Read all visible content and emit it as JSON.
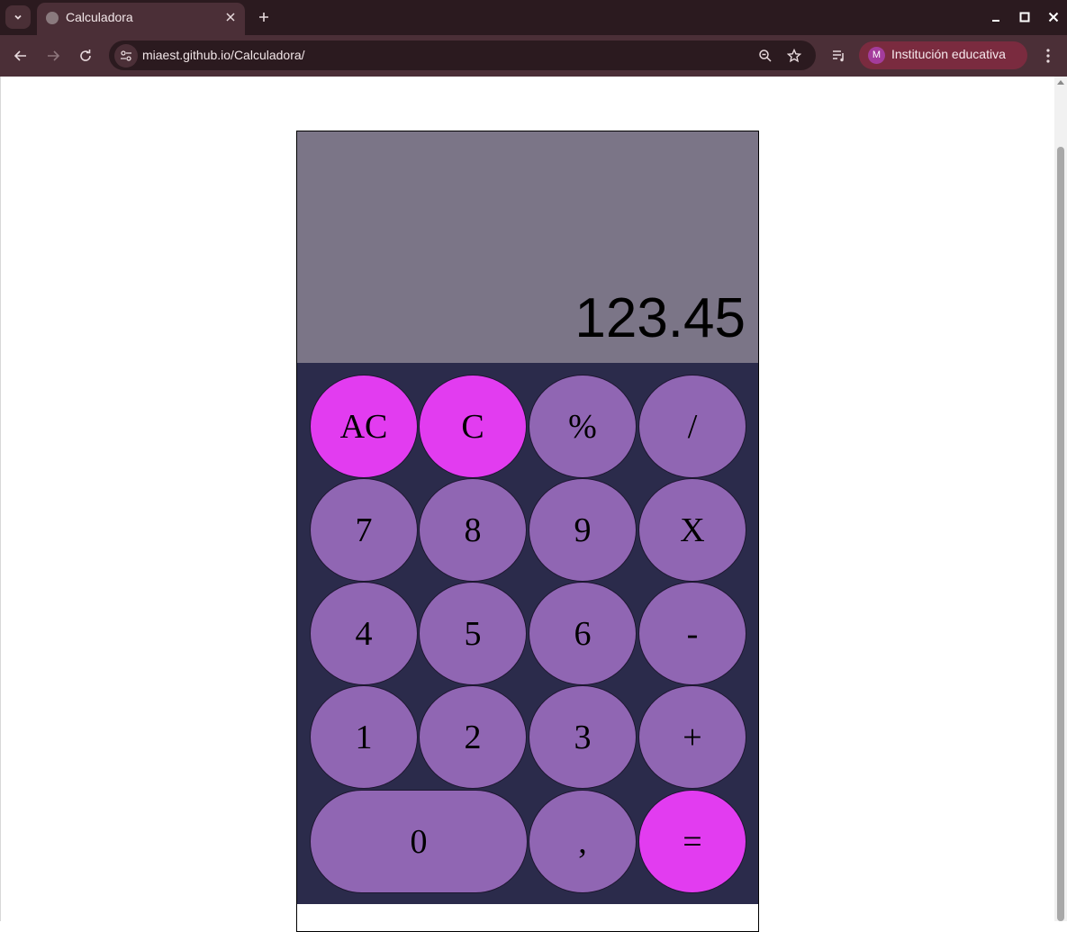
{
  "browser": {
    "tab_title": "Calculadora",
    "url": "miaest.github.io/Calculadora/",
    "profile_initial": "M",
    "profile_name": "Institución educativa"
  },
  "calculator": {
    "display": "123.45",
    "colors": {
      "display_bg": "#7b7587",
      "keypad_bg": "#2b2b4b",
      "key": "#9066b3",
      "accent_key": "#e23cf0"
    },
    "keys": {
      "ac": "AC",
      "c": "C",
      "percent": "%",
      "divide": "/",
      "seven": "7",
      "eight": "8",
      "nine": "9",
      "multiply": "X",
      "four": "4",
      "five": "5",
      "six": "6",
      "minus": "-",
      "one": "1",
      "two": "2",
      "three": "3",
      "plus": "+",
      "zero": "0",
      "comma": ",",
      "equals": "="
    }
  }
}
